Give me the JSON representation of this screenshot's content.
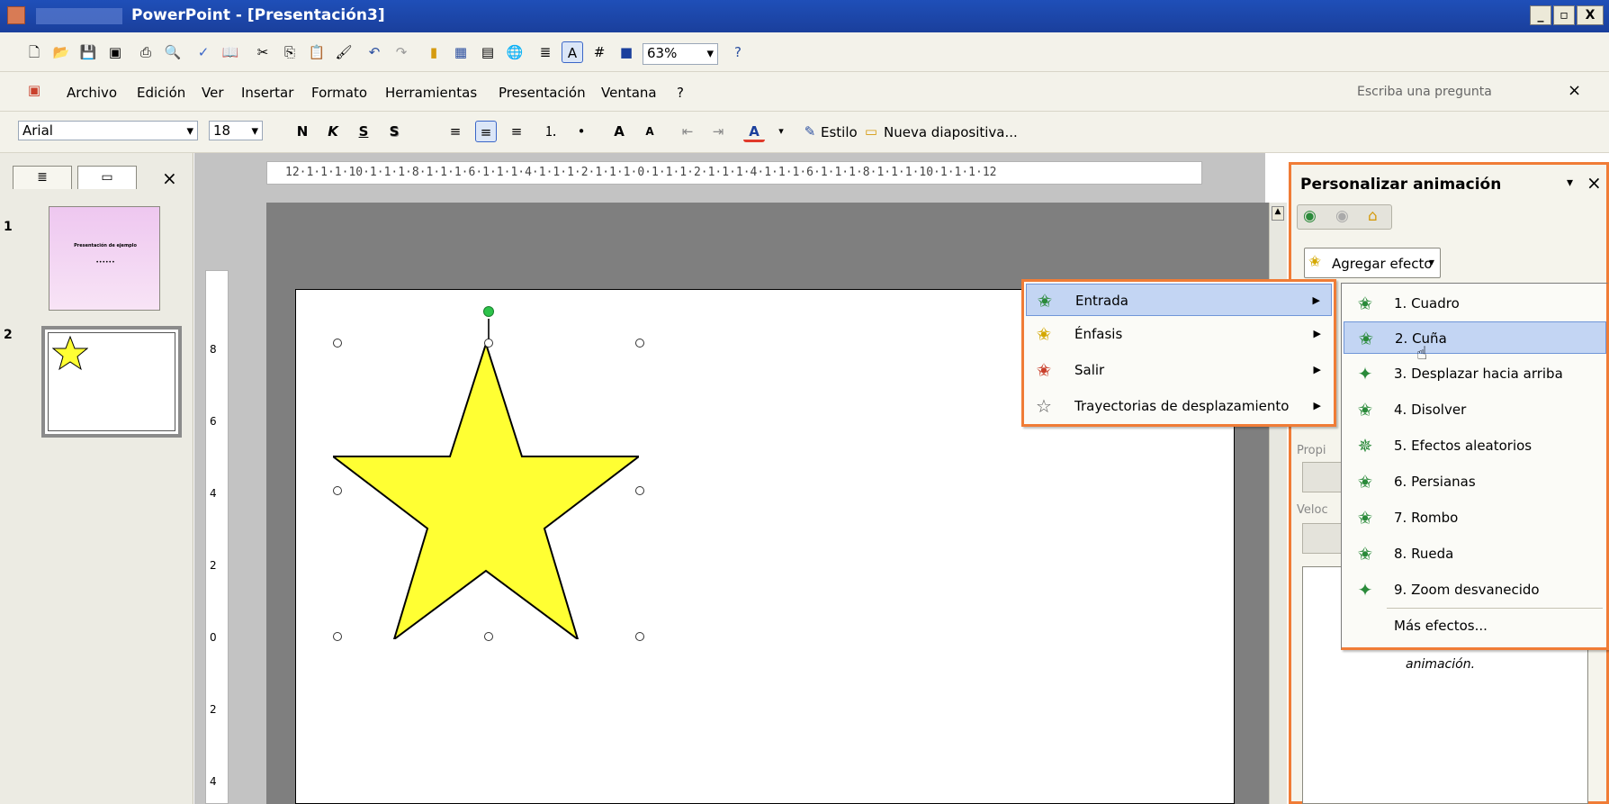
{
  "window": {
    "title": "PowerPoint - [Presentación3]",
    "min_label": "_",
    "max_label": "▫",
    "close_label": "X"
  },
  "toolbar": {
    "zoom_value": "63%",
    "zoom_arrow": "▾"
  },
  "menubar": {
    "items": [
      "Archivo",
      "Edición",
      "Ver",
      "Insertar",
      "Formato",
      "Herramientas",
      "Presentación",
      "Ventana",
      "?"
    ],
    "help_placeholder": "Escriba una pregunta",
    "close_doc": "×"
  },
  "format_bar": {
    "font_name": "Arial",
    "font_size": "18",
    "bold": "N",
    "italic": "K",
    "underline": "S",
    "shadow": "S",
    "style_label": "Estilo",
    "new_slide_label": "Nueva diapositiva..."
  },
  "slides_pane": {
    "close": "×",
    "slides": [
      {
        "number": "1",
        "title": "Presentación de ejemplo",
        "subtitle": "••••••"
      },
      {
        "number": "2"
      }
    ]
  },
  "ruler": {
    "text": "12·1·1·1·10·1·1·1·8·1·1·1·6·1·1·1·4·1·1·1·2·1·1·1·0·1·1·1·2·1·1·1·4·1·1·1·6·1·1·1·8·1·1·1·10·1·1·1·12",
    "vertical_labels": [
      "8",
      "6",
      "4",
      "2",
      "0",
      "2",
      "4"
    ]
  },
  "task_pane": {
    "title": "Personalizar animación",
    "dropdown_arrow": "▾",
    "close": "×",
    "add_effect_label": "Agregar efecto",
    "add_effect_arrow": "▾",
    "prop_label": "Propi",
    "speed_label": "Veloc",
    "hint_text": "animación."
  },
  "effect_menu": {
    "items": [
      {
        "label": "Entrada",
        "selected": true,
        "icon": "star-green-icon",
        "color": "#2a8a3a"
      },
      {
        "label": "Énfasis",
        "selected": false,
        "icon": "star-yellow-icon",
        "color": "#d4a800"
      },
      {
        "label": "Salir",
        "selected": false,
        "icon": "star-red-icon",
        "color": "#c9402c"
      },
      {
        "label": "Trayectorias de desplazamiento",
        "selected": false,
        "icon": "star-outline-icon",
        "color": "#555555"
      }
    ]
  },
  "entrance_submenu": {
    "items": [
      {
        "label": "1. Cuadro",
        "selected": false
      },
      {
        "label": "2. Cuña",
        "selected": true
      },
      {
        "label": "3. Desplazar hacia arriba",
        "selected": false
      },
      {
        "label": "4. Disolver",
        "selected": false
      },
      {
        "label": "5. Efectos aleatorios",
        "selected": false
      },
      {
        "label": "6. Persianas",
        "selected": false
      },
      {
        "label": "7. Rombo",
        "selected": false
      },
      {
        "label": "8. Rueda",
        "selected": false
      },
      {
        "label": "9. Zoom desvanecido",
        "selected": false
      },
      {
        "label": "Más efectos...",
        "selected": false
      }
    ]
  },
  "colors": {
    "accent_orange": "#f07c36",
    "star_fill": "#ffff33",
    "title_blue": "#1f4fb8"
  }
}
